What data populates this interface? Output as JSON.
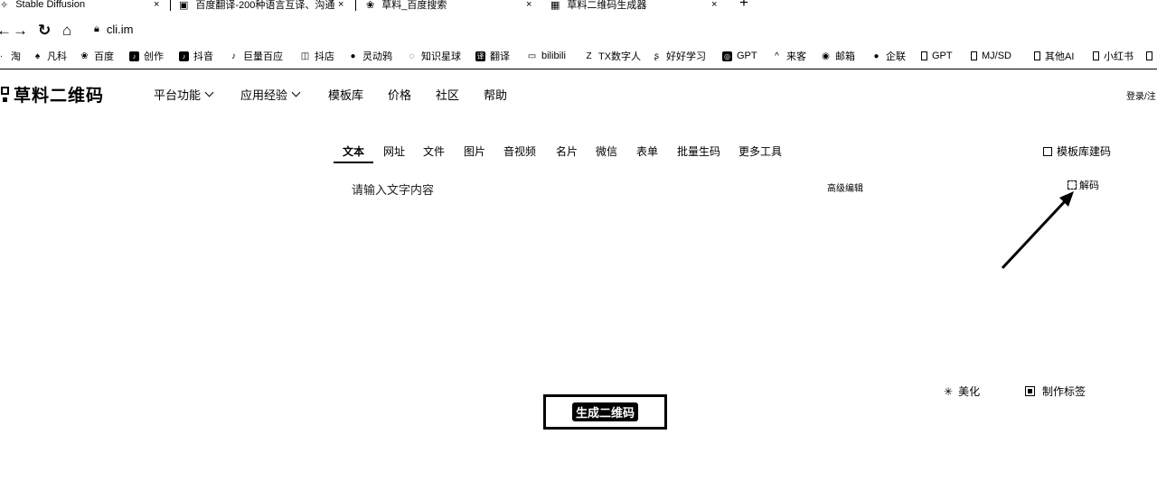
{
  "browser": {
    "tabs": [
      {
        "label": "Stable Diffusion",
        "icon": "diffusion-icon"
      },
      {
        "label": "百度翻译-200种语言互译、沟通",
        "icon": "translate-icon"
      },
      {
        "label": "草料_百度搜索",
        "icon": "paw-icon"
      },
      {
        "label": "草料二维码生成器",
        "icon": "qr-icon"
      }
    ],
    "new_tab": "+",
    "close": "×",
    "url": "cli.im",
    "bookmarks": [
      "淘",
      "凡科",
      "百度",
      "创作",
      "抖音",
      "巨量百应",
      "抖店",
      "灵动鸦",
      "知识星球",
      "翻译",
      "bilibili",
      "TX数字人",
      "好好学习",
      "GPT",
      "来客",
      "邮箱",
      "企联",
      "GPT",
      "MJ/SD",
      "其他AI",
      "小红书"
    ]
  },
  "site": {
    "logo_text": "草料二维码",
    "nav": [
      "平台功能",
      "应用经验",
      "模板库",
      "价格",
      "社区",
      "帮助"
    ],
    "login_text": "登录/注"
  },
  "type_tabs": [
    "文本",
    "网址",
    "文件",
    "图片",
    "音视频",
    "名片",
    "微信",
    "表单",
    "批量生码",
    "更多工具"
  ],
  "template_code_label": "模板库建码",
  "editor": {
    "placeholder": "请输入文字内容",
    "advanced_label": "高级编辑",
    "decode_label": "解码"
  },
  "actions": {
    "beautify_label": "美化",
    "make_label_label": "制作标签",
    "generate_label": "生成二维码"
  }
}
